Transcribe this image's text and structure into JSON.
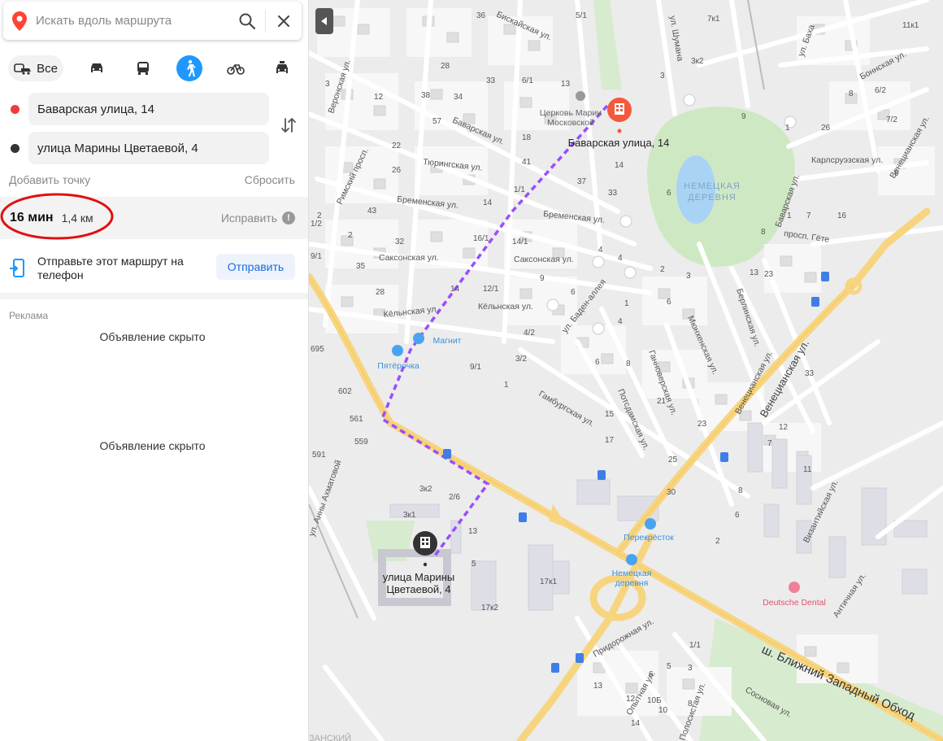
{
  "search": {
    "placeholder": "Искать вдоль маршрута"
  },
  "modes": {
    "all_label": "Все"
  },
  "route": {
    "from": "Баварская улица, 14",
    "to": "улица Марины Цветаевой, 4",
    "add_point": "Добавить точку",
    "reset": "Сбросить",
    "time": "16 мин",
    "distance": "1,4 км",
    "fix": "Исправить"
  },
  "send": {
    "text": "Отправьте этот маршрут на телефон",
    "button": "Отправить"
  },
  "ads": {
    "label": "Реклама",
    "hidden1": "Объявление скрыто",
    "hidden2": "Объявление скрыто"
  },
  "colors": {
    "accent": "#1e98ff",
    "route": "#9b4dff",
    "start_dot": "#f03b3b",
    "end_dot": "#333333"
  },
  "map": {
    "dest_label": "Баварская улица, 14",
    "origin_label_1": "улица Марины",
    "origin_label_2": "Цветаевой, 4",
    "village_1": "НЕМЕЦКАЯ",
    "village_2": "ДЕРЕВНЯ",
    "church_1": "Церковь Марии",
    "church_2": "Московской",
    "highway": "ш. Ближний Западный Обход",
    "pois": {
      "magnit": "Магнит",
      "pyaterochka": "Пятёрочка",
      "perekrestok": "Перекрёсток",
      "nemetskaya_1": "Немецкая",
      "nemetskaya_2": "деревня",
      "dental": "Deutsche Dental"
    },
    "streets": {
      "biskayskaya": "Бискайская ул.",
      "shumana": "ул. Шумана",
      "bakha": "ул. Баха",
      "bonnskaya": "Боннская ул.",
      "veronskaya": "Веронская ул.",
      "bavarskaya_top": "Баварская ул.",
      "bavarskaya_right": "Баварская ул.",
      "tyuringskaya": "Тюрингская ул.",
      "rimsky": "Римский просп.",
      "bremenskaya_left": "Бременская ул.",
      "bremenskaya_right": "Бременская ул.",
      "karlsruezskaya": "Карлсруэзская ул.",
      "veneciansk_top": "Венецианская ул.",
      "saksonskaya_left": "Саксонская ул.",
      "saksonskaya_right": "Саксонская ул.",
      "gete": "просп. Гёте",
      "kyolnskaya_left": "Кёльнская ул.",
      "kyolnskaya_right": "Кёльнская ул.",
      "baden": "ул. Баден-аллея",
      "berlinskaya": "Берлинская ул.",
      "myunhenskaya": "Мюнхенская ул.",
      "gannoverskaya": "Ганноверская ул.",
      "potsdamskaya": "Потсдамская ул.",
      "gamburgskaya": "Гамбургская ул.",
      "veneciansk_side": "Венецианская ул.",
      "veneciansk_main": "Венецианская ул.",
      "vizantiyskaya": "Византийская ул.",
      "antichnaya": "Античная ул.",
      "akhmatovoy": "ул. Анны Ахматовой",
      "pridorozhnaya": "Придорожная ул.",
      "opytnaya": "Опытная ул.",
      "sosnovaya": "Сосновая ул.",
      "polosistaya": "Полосистая ул.",
      "kazanskiy": "ЗАНСКИЙ"
    }
  }
}
